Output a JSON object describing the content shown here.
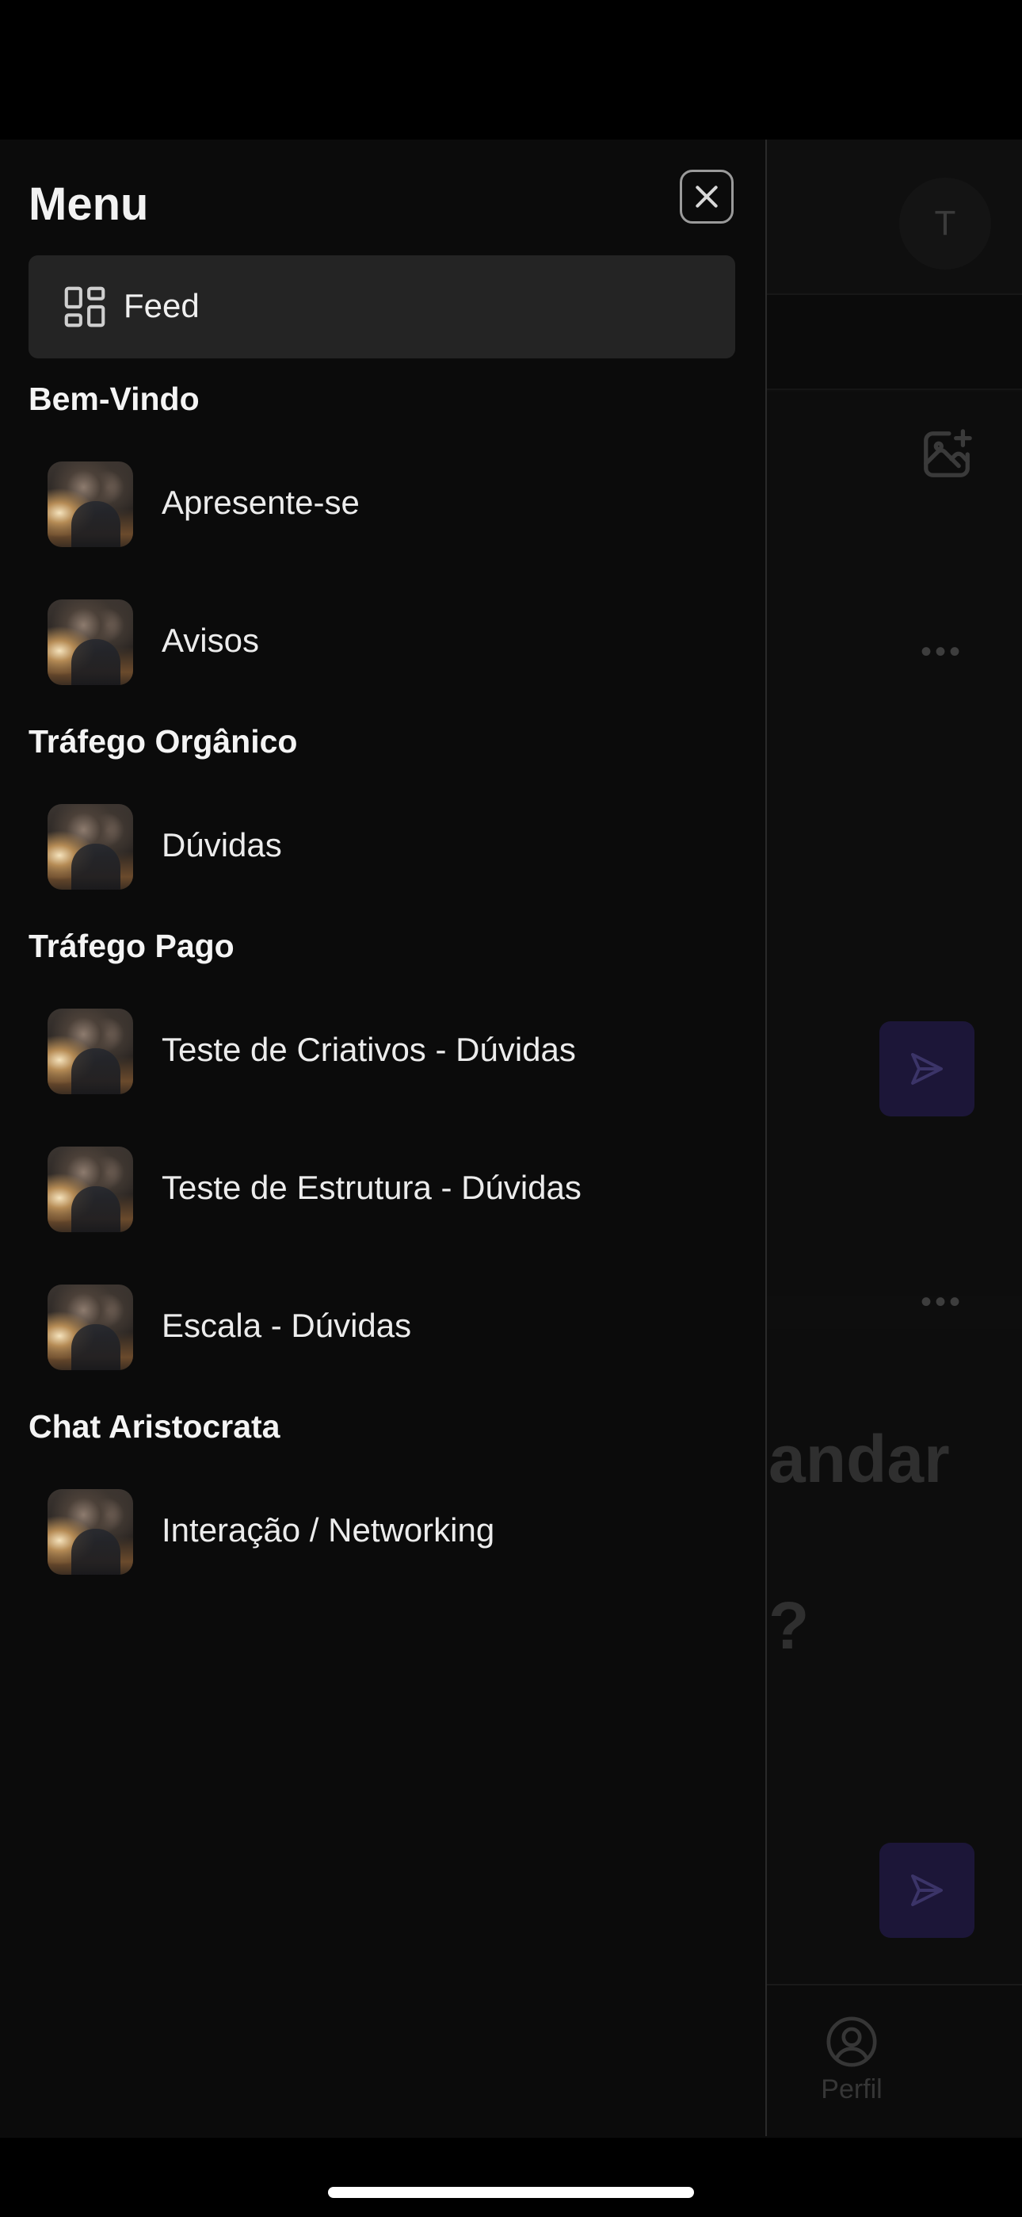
{
  "background_app": {
    "avatar_initial": "T",
    "big_text_1": "andar",
    "big_text_2": "?",
    "tab_profile_label": "Perfil"
  },
  "drawer": {
    "title": "Menu",
    "feed_label": "Feed",
    "sections": [
      {
        "title": "Bem-Vindo",
        "channels": [
          {
            "label": "Apresente-se"
          },
          {
            "label": "Avisos"
          }
        ]
      },
      {
        "title": "Tráfego Orgânico",
        "channels": [
          {
            "label": "Dúvidas"
          }
        ]
      },
      {
        "title": "Tráfego Pago",
        "channels": [
          {
            "label": "Teste de Criativos - Dúvidas"
          },
          {
            "label": "Teste de Estrutura - Dúvidas"
          },
          {
            "label": "Escala - Dúvidas"
          }
        ]
      },
      {
        "title": "Chat Aristocrata",
        "channels": [
          {
            "label": "Interação / Networking"
          }
        ]
      }
    ]
  },
  "colors": {
    "drawer_bg": "#0b0b0b",
    "feed_item_bg": "#242424",
    "accent_send": "#1c1638"
  }
}
